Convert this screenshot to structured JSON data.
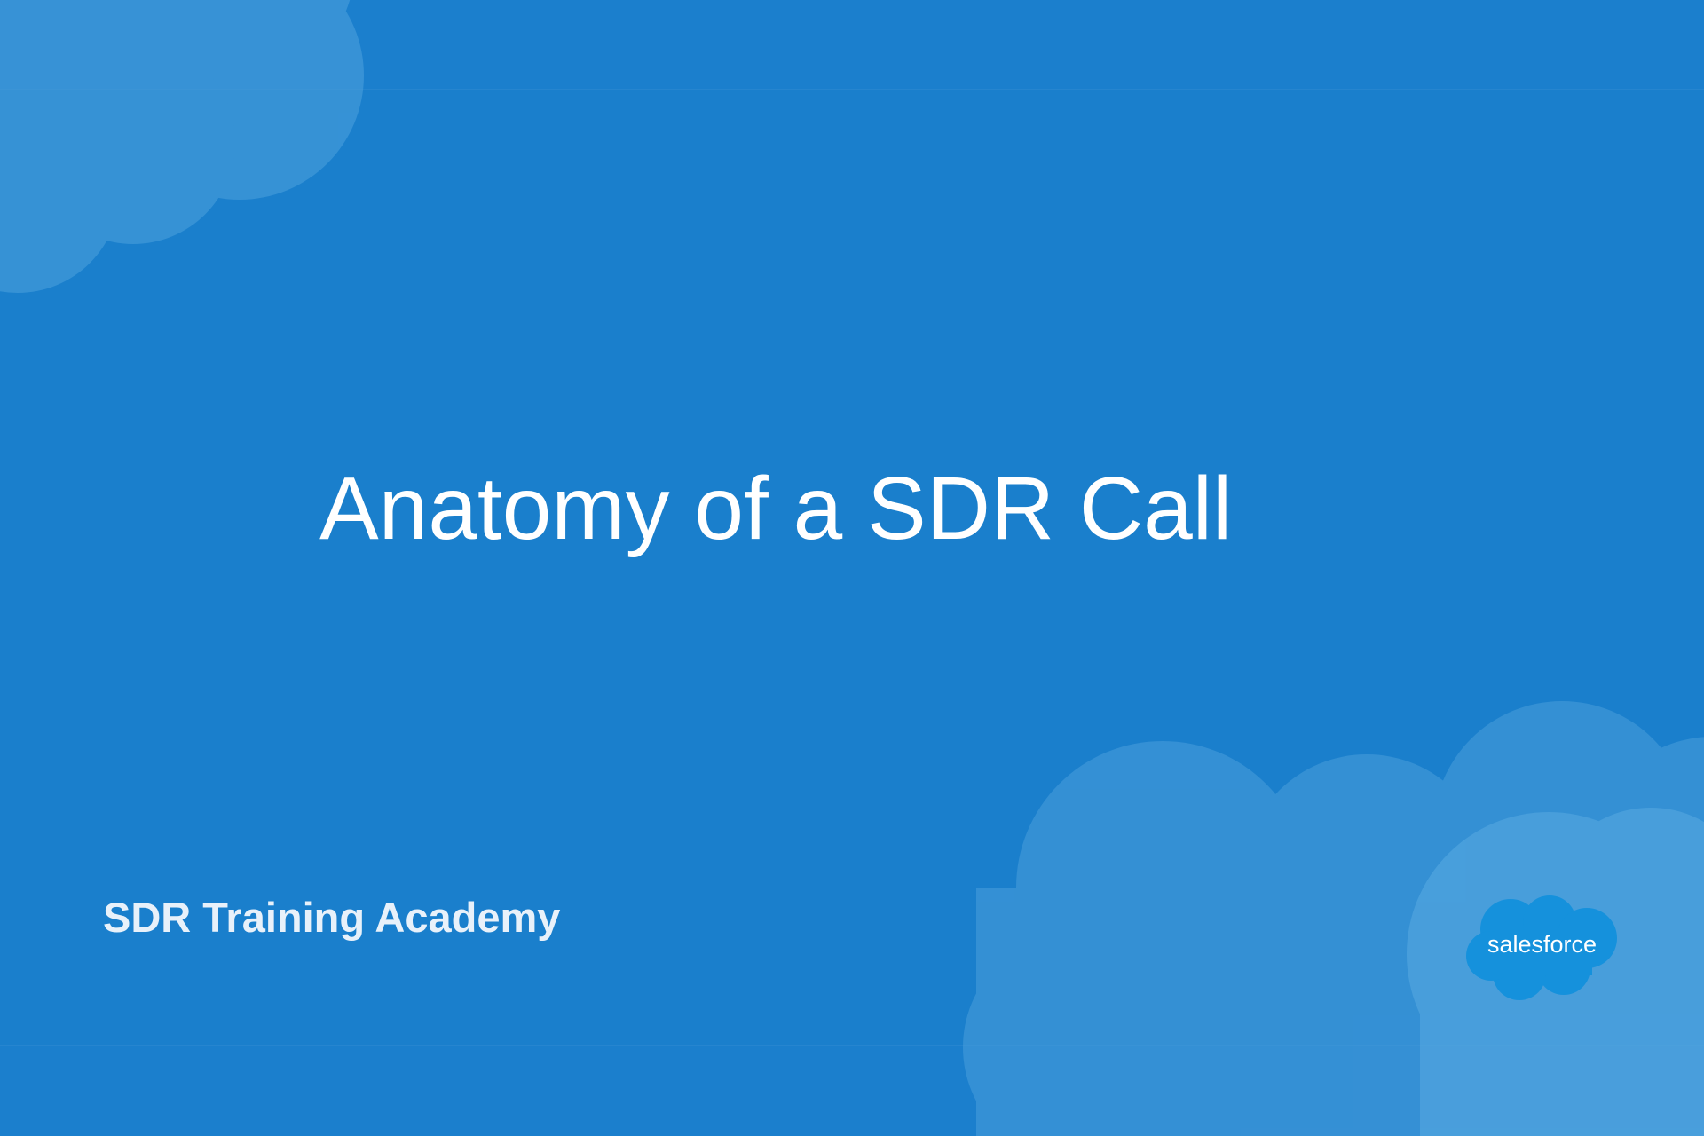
{
  "slide": {
    "title": "Anatomy of a SDR Call",
    "subtitle": "SDR Training Academy",
    "logo_text": "salesforce"
  },
  "colors": {
    "background": "#1a7fcc",
    "cloud_light": "#4a9fdc",
    "logo_blue": "#1591dc",
    "text": "#ffffff"
  },
  "icons": {
    "logo": "salesforce-cloud-logo",
    "decor": "cloud-shape"
  }
}
